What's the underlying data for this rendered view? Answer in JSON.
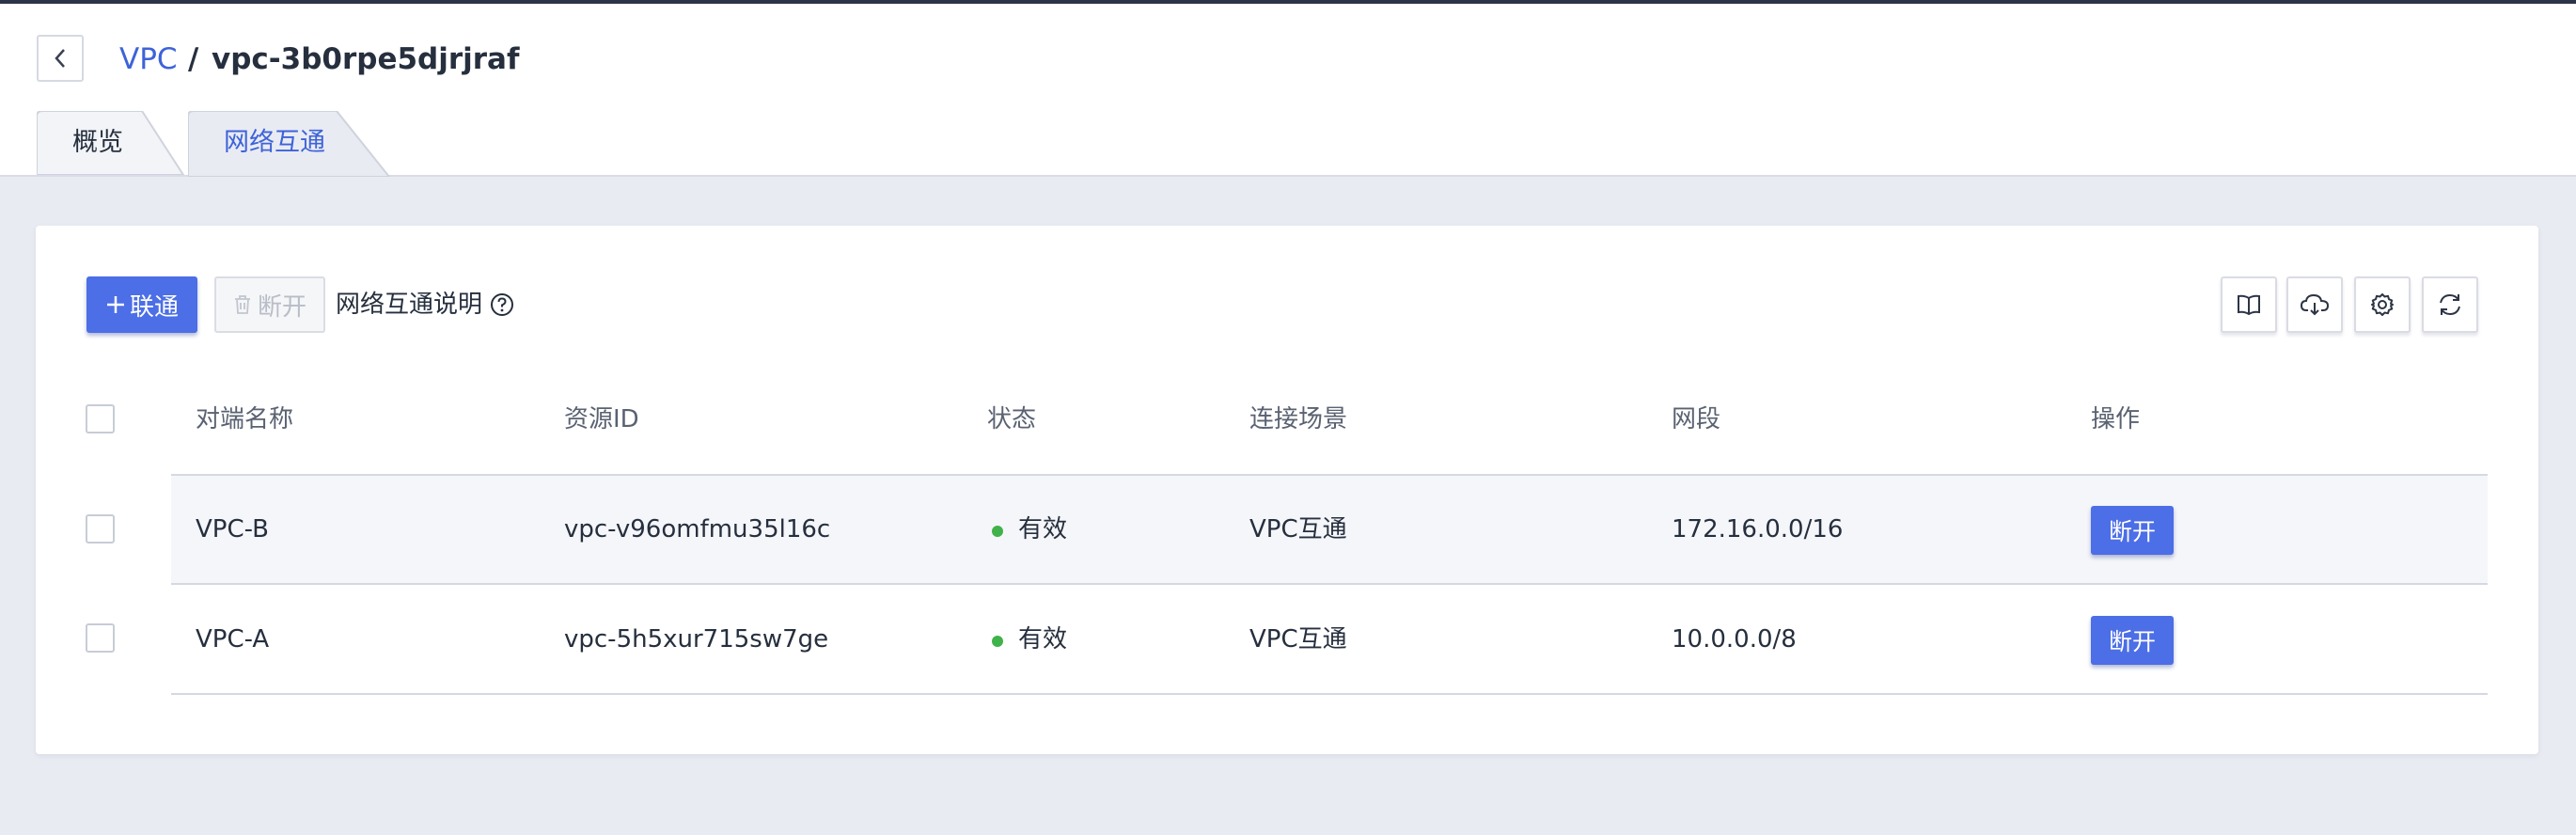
{
  "breadcrumb": {
    "parent": "VPC",
    "separator": "/",
    "current": "vpc-3b0rpe5djrjraf"
  },
  "tabs": [
    {
      "label": "概览",
      "active": false
    },
    {
      "label": "网络互通",
      "active": true
    }
  ],
  "toolbar": {
    "connect_label": "联通",
    "disconnect_label": "断开",
    "help_label": "网络互通说明",
    "icons": [
      "book-icon",
      "cloud-download-icon",
      "gear-icon",
      "refresh-icon"
    ]
  },
  "table": {
    "columns": [
      "对端名称",
      "资源ID",
      "状态",
      "连接场景",
      "网段",
      "操作"
    ],
    "rows": [
      {
        "name": "VPC-B",
        "resource_id": "vpc-v96omfmu35l16c",
        "status": "有效",
        "scene": "VPC互通",
        "cidr": "172.16.0.0/16",
        "action": "断开"
      },
      {
        "name": "VPC-A",
        "resource_id": "vpc-5h5xur715sw7ge",
        "status": "有效",
        "scene": "VPC互通",
        "cidr": "10.0.0.0/8",
        "action": "断开"
      }
    ]
  },
  "colors": {
    "accent": "#4c6ee6",
    "link": "#3e63d8",
    "status_ok": "#3fb24a",
    "page_bg": "#e9ebf3"
  }
}
